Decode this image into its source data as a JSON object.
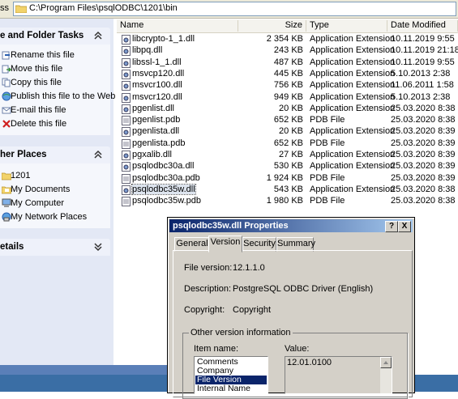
{
  "address": {
    "label": "ss",
    "path": "C:\\Program Files\\psqlODBC\\1201\\bin"
  },
  "taskpane": {
    "file_tasks": {
      "title": "e and Folder Tasks",
      "items": [
        {
          "label": "Rename this file",
          "icon": "rename-icon"
        },
        {
          "label": "Move this file",
          "icon": "move-icon"
        },
        {
          "label": "Copy this file",
          "icon": "copy-icon"
        },
        {
          "label": "Publish this file to the Web",
          "icon": "publish-icon"
        },
        {
          "label": "E-mail this file",
          "icon": "email-icon"
        },
        {
          "label": "Delete this file",
          "icon": "delete-icon"
        }
      ]
    },
    "other_places": {
      "title": "her Places",
      "items": [
        {
          "label": "1201",
          "icon": "folder-icon"
        },
        {
          "label": "My Documents",
          "icon": "documents-icon"
        },
        {
          "label": "My Computer",
          "icon": "computer-icon"
        },
        {
          "label": "My Network Places",
          "icon": "network-icon"
        }
      ]
    },
    "details": {
      "title": "etails"
    }
  },
  "filelist": {
    "columns": {
      "name": "Name",
      "size": "Size",
      "type": "Type",
      "date": "Date Modified"
    },
    "rows": [
      {
        "name": "libcrypto-1_1.dll",
        "size": "2 354 KB",
        "type": "Application Extension",
        "date": "10.11.2019 9:55",
        "icon": "dll"
      },
      {
        "name": "libpq.dll",
        "size": "243 KB",
        "type": "Application Extension",
        "date": "10.11.2019 21:18",
        "icon": "dll"
      },
      {
        "name": "libssl-1_1.dll",
        "size": "487 KB",
        "type": "Application Extension",
        "date": "10.11.2019 9:55",
        "icon": "dll"
      },
      {
        "name": "msvcp120.dll",
        "size": "445 KB",
        "type": "Application Extension",
        "date": "5.10.2013 2:38",
        "icon": "dll"
      },
      {
        "name": "msvcr100.dll",
        "size": "756 KB",
        "type": "Application Extension",
        "date": "11.06.2011 1:58",
        "icon": "dll"
      },
      {
        "name": "msvcr120.dll",
        "size": "949 KB",
        "type": "Application Extension",
        "date": "5.10.2013 2:38",
        "icon": "dll"
      },
      {
        "name": "pgenlist.dll",
        "size": "20 KB",
        "type": "Application Extension",
        "date": "25.03.2020 8:38",
        "icon": "dll"
      },
      {
        "name": "pgenlist.pdb",
        "size": "652 KB",
        "type": "PDB File",
        "date": "25.03.2020 8:38",
        "icon": "pdb"
      },
      {
        "name": "pgenlista.dll",
        "size": "20 KB",
        "type": "Application Extension",
        "date": "25.03.2020 8:39",
        "icon": "dll"
      },
      {
        "name": "pgenlista.pdb",
        "size": "652 KB",
        "type": "PDB File",
        "date": "25.03.2020 8:39",
        "icon": "pdb"
      },
      {
        "name": "pgxalib.dll",
        "size": "27 KB",
        "type": "Application Extension",
        "date": "25.03.2020 8:39",
        "icon": "dll"
      },
      {
        "name": "psqlodbc30a.dll",
        "size": "530 KB",
        "type": "Application Extension",
        "date": "25.03.2020 8:39",
        "icon": "dll"
      },
      {
        "name": "psqlodbc30a.pdb",
        "size": "1 924 KB",
        "type": "PDB File",
        "date": "25.03.2020 8:39",
        "icon": "pdb"
      },
      {
        "name": "psqlodbc35w.dll",
        "size": "543 KB",
        "type": "Application Extension",
        "date": "25.03.2020 8:38",
        "icon": "dll",
        "selected": true
      },
      {
        "name": "psqlodbc35w.pdb",
        "size": "1 980 KB",
        "type": "PDB File",
        "date": "25.03.2020 8:38",
        "icon": "pdb"
      }
    ]
  },
  "dialog": {
    "title": "psqlodbc35w.dll Properties",
    "help_btn": "?",
    "close_btn": "X",
    "tabs": [
      "General",
      "Version",
      "Security",
      "Summary"
    ],
    "active_tab": "Version",
    "file_version_label": "File version:",
    "file_version": "12.1.1.0",
    "description_label": "Description:",
    "description": "PostgreSQL ODBC Driver (English)",
    "copyright_label": "Copyright:",
    "copyright": "Copyright",
    "other_info_label": "Other version information",
    "item_name_label": "Item name:",
    "value_label": "Value:",
    "items": [
      "Comments",
      "Company",
      "File Version",
      "Internal Name"
    ],
    "selected_item": "File Version",
    "value": "12.01.0100"
  },
  "colors": {
    "title_start": "#0a246a",
    "title_end": "#a6caf0",
    "taskpane_bg": "#e3e8f5",
    "selection": "#0a246a"
  }
}
